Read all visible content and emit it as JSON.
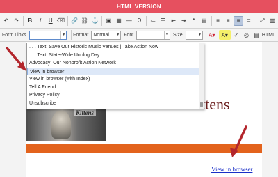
{
  "banner": {
    "title": "HTML VERSION"
  },
  "toolbar2": {
    "form_links_label": "Form Links",
    "form_links_value": "",
    "format_label": "Format",
    "format_value": "Normal",
    "font_label": "Font",
    "font_value": "",
    "size_label": "Size",
    "size_value": "",
    "html_label": "HTML"
  },
  "toolbar1": {
    "bold": "B",
    "italic": "I",
    "underline": "U"
  },
  "dropdown": {
    "items": [
      ". . . Text: Save Our Historic Music Venues | Take Action Now",
      ". . . Text: State-Wide Unplug Day",
      "Advocacy: Our Nonprofit Action Network",
      "View in browser",
      "View in browser (with Index)",
      "Tell A Friend",
      "Privacy Policy",
      "Unsubscribe"
    ],
    "selected_index": 3
  },
  "page": {
    "heading_fragment": "ttens",
    "photo_caption": "Kittens",
    "view_link": "View in browser"
  },
  "colors": {
    "banner": "#e6505f",
    "orange_bar": "#e3631d",
    "arrow": "#b3262c",
    "link": "#1a2fc7",
    "heading": "#6a1d1d"
  }
}
